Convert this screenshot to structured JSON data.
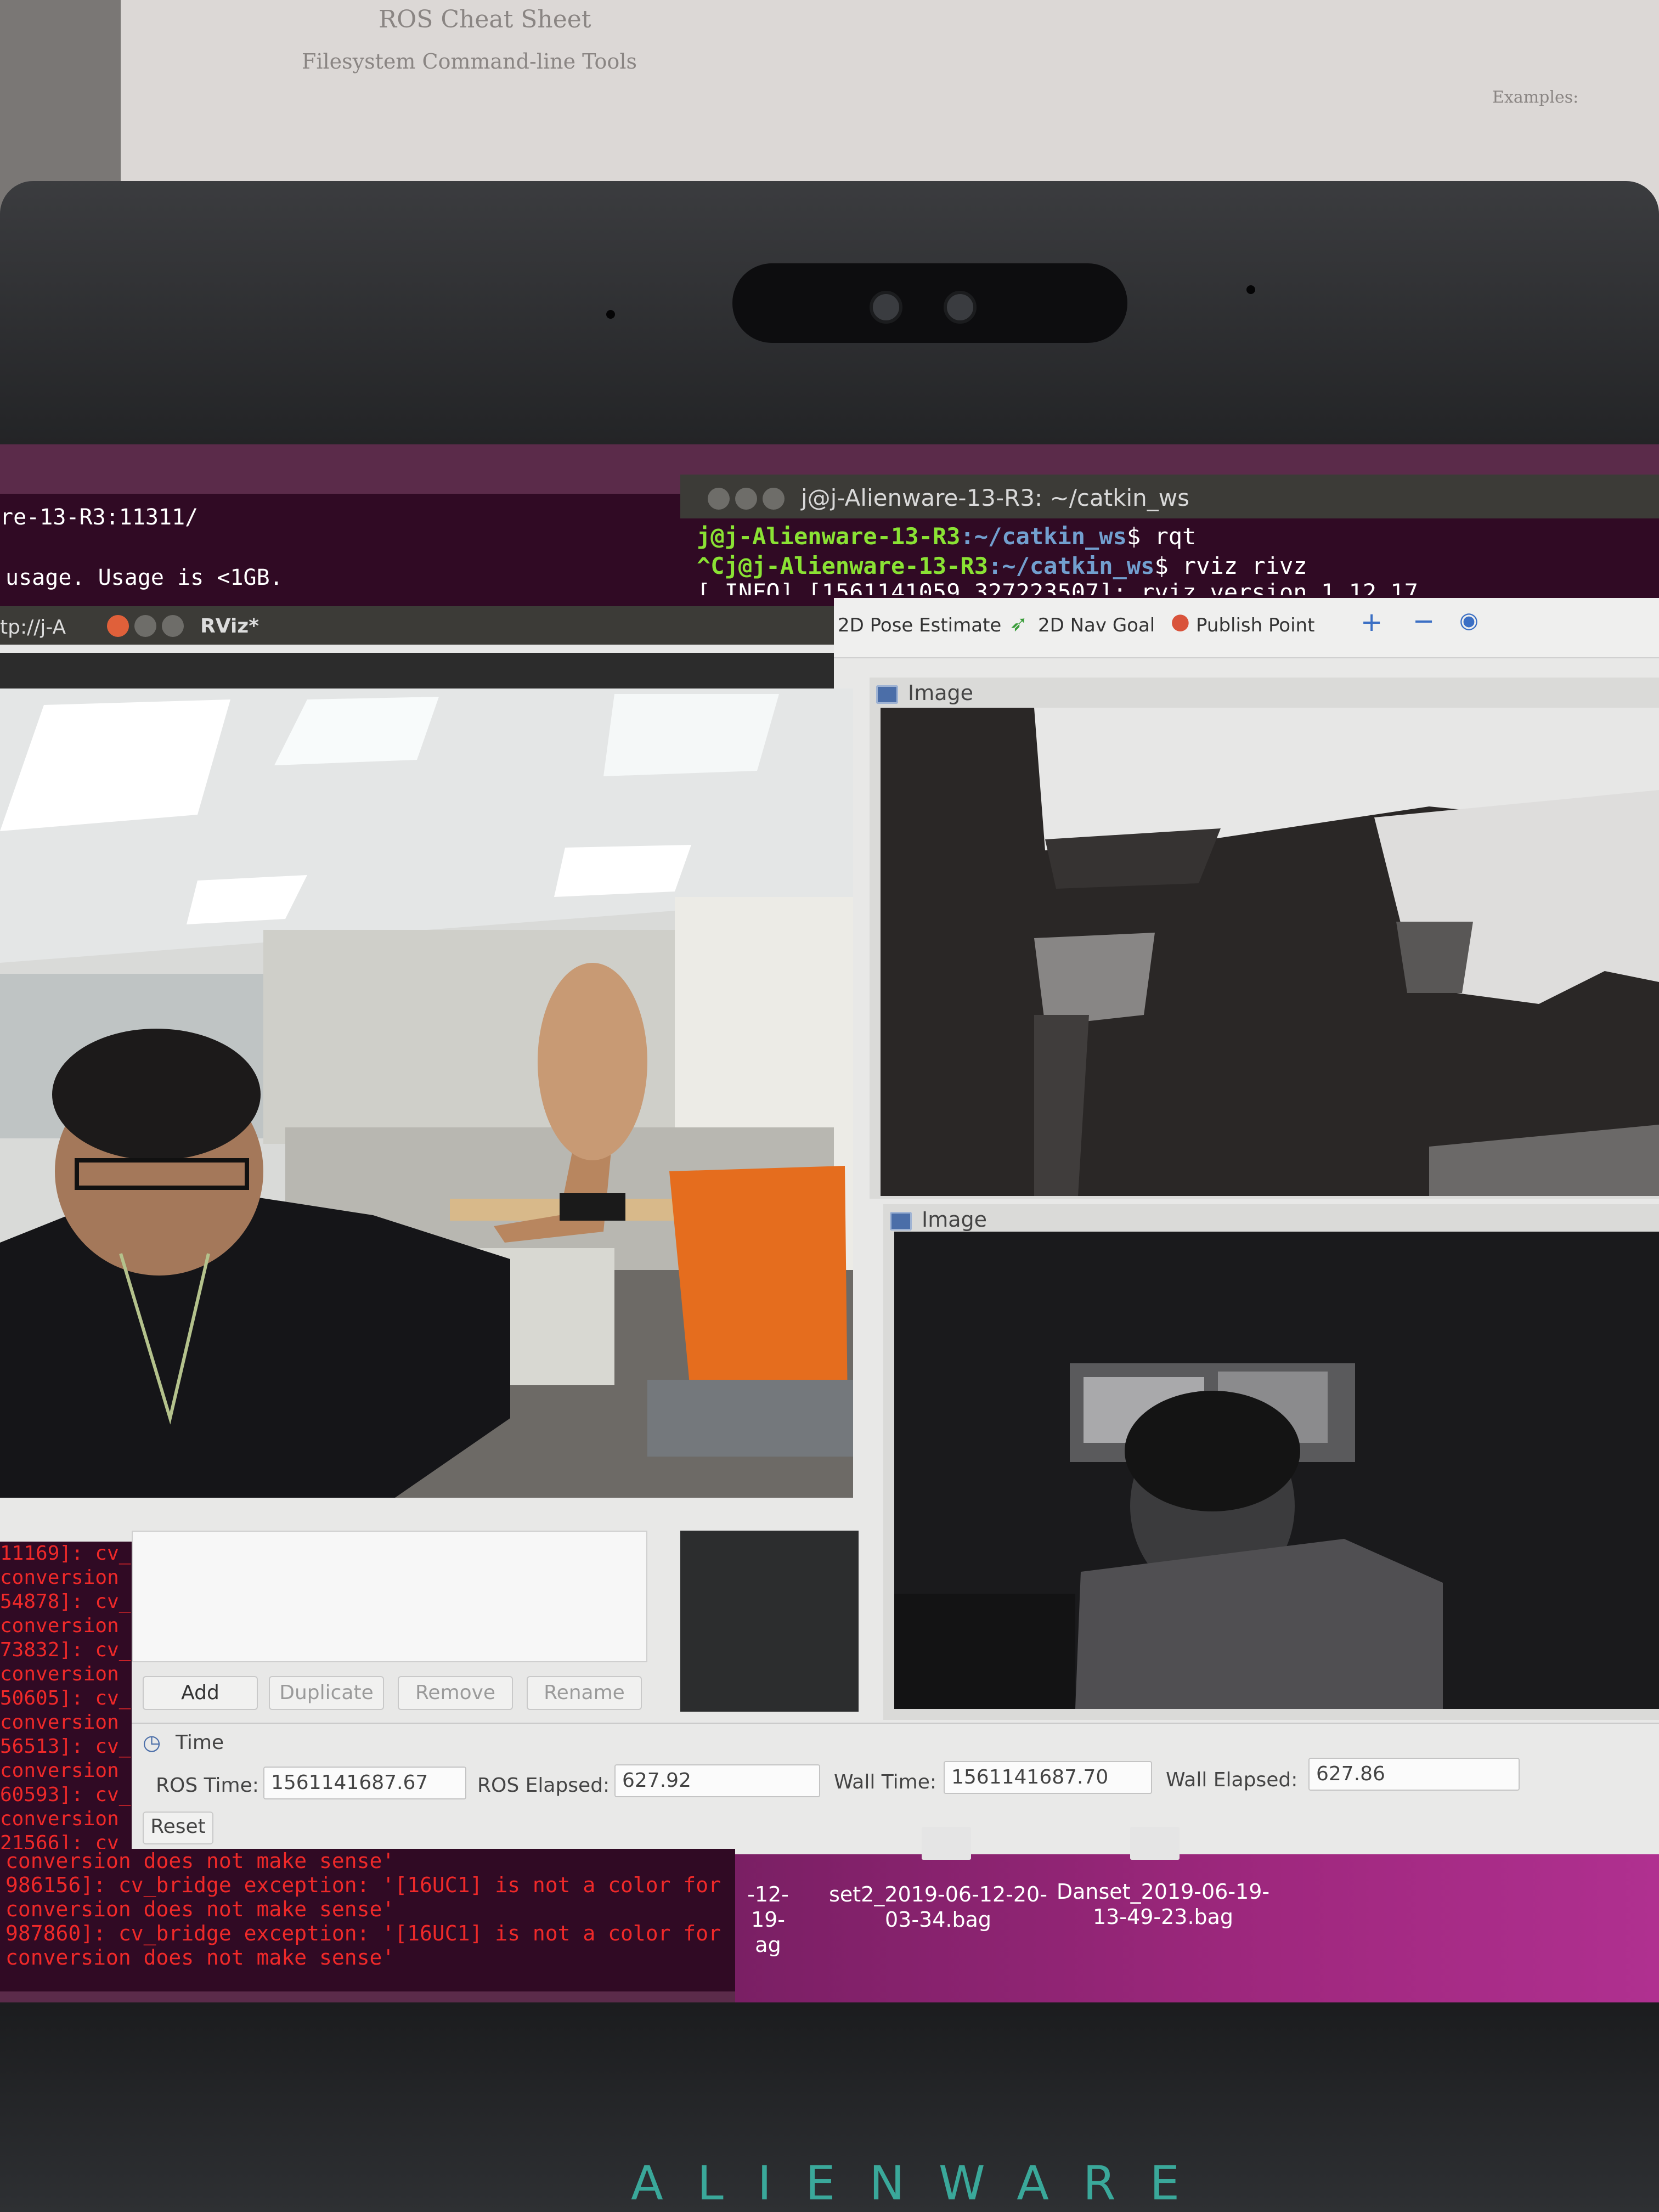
{
  "brand": "ALIENWARE",
  "cheat_sheet": {
    "title": "ROS Cheat Sheet",
    "section": "Filesystem Command-line Tools",
    "right_examples": "Examples:"
  },
  "terminal": {
    "title": "j@j-Alienware-13-R3: ~/catkin_ws",
    "left_host": "re-13-R3:11311/",
    "left_usage": "usage. Usage is <1GB.",
    "left_url": "tp://j-A",
    "lines": [
      {
        "user": "j@j-Alienware-13-R3",
        "path": ":~/catkin_ws",
        "cmd": "$ rqt"
      },
      {
        "user": "^Cj@j-Alienware-13-R3",
        "path": ":~/catkin_ws",
        "cmd": "$ rviz rivz"
      }
    ],
    "partial_line": "[ INFO] [1561141059.327223507]: rviz version 1.12.17"
  },
  "rviz": {
    "window_title": "RViz*",
    "toolbar": {
      "pose_estimate": "2D Pose Estimate",
      "nav_goal": "2D Nav Goal",
      "publish_point": "Publish Point"
    },
    "panels": {
      "image_top": "Image",
      "image_bottom": "Image"
    },
    "display_buttons": {
      "add": "Add",
      "duplicate": "Duplicate",
      "remove": "Remove",
      "rename": "Rename"
    },
    "time": {
      "title": "Time",
      "ros_time_label": "ROS Time:",
      "ros_time": "1561141687.67",
      "ros_elapsed_label": "ROS Elapsed:",
      "ros_elapsed": "627.92",
      "wall_time_label": "Wall Time:",
      "wall_time": "1561141687.70",
      "wall_elapsed_label": "Wall Elapsed:",
      "wall_elapsed": "627.86",
      "reset": "Reset"
    }
  },
  "error_terminal": {
    "side_lines": [
      "11169]: cv_",
      "conversion",
      "54878]: cv_",
      "conversion",
      "73832]: cv_",
      "conversion",
      "50605]: cv_",
      "conversion",
      "56513]: cv_",
      "conversion",
      "60593]: cv_",
      "conversion",
      "21566]: cv_"
    ],
    "bottom_lines": [
      "conversion does not make sense'",
      "986156]: cv_bridge exception: '[16UC1] is not a color for",
      "conversion does not make sense'",
      "987860]: cv_bridge exception: '[16UC1] is not a color for",
      "conversion does not make sense'"
    ]
  },
  "desktop_files": [
    {
      "name": "-12-19-",
      "name2": "ag"
    },
    {
      "name": "set2_2019-06-12-20-",
      "name2": "03-34.bag"
    },
    {
      "name": "Danset_2019-06-19-",
      "name2": "13-49-23.bag"
    }
  ],
  "colors": {
    "terminal_bg": "#300a24",
    "prompt_green": "#8ae234",
    "prompt_blue": "#729fcf",
    "error_red": "#ef2929",
    "brand_teal": "#3aa89a"
  }
}
